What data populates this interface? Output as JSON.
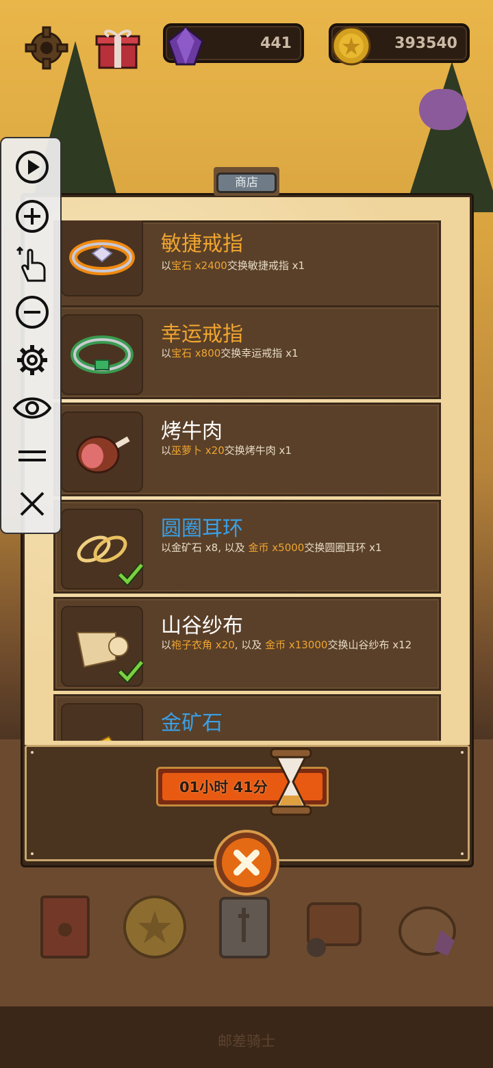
{
  "resources": {
    "gems": "441",
    "coins": "393540"
  },
  "shop": {
    "tab_label": "商店",
    "items": [
      {
        "name": "敏捷戒指",
        "name_color": "#f0a530",
        "desc_pre": "以",
        "desc_hl": "宝石 x2400",
        "desc_post": "交换敏捷戒指 x1",
        "icon": "agility-ring-icon",
        "owned": false
      },
      {
        "name": "幸运戒指",
        "name_color": "#f0a530",
        "desc_pre": "以",
        "desc_hl": "宝石 x800",
        "desc_post": "交换幸运戒指 x1",
        "icon": "luck-ring-icon",
        "owned": false
      },
      {
        "name": "烤牛肉",
        "name_color": "#ffffff",
        "desc_pre": "以",
        "desc_hl": "巫萝卜 x20",
        "desc_post": "交换烤牛肉 x1",
        "icon": "roast-beef-icon",
        "owned": false
      },
      {
        "name": "圆圈耳环",
        "name_color": "#3aa0e8",
        "desc_pre": "以金矿石 x8, 以及 ",
        "desc_hl": "金币 x5000",
        "desc_post": "交换圆圈耳环 x1",
        "icon": "hoop-earring-icon",
        "owned": true
      },
      {
        "name": "山谷纱布",
        "name_color": "#ffffff",
        "desc_pre": "以",
        "desc_hl": "袍子衣角 x20",
        "desc_mid": ", 以及 ",
        "desc_hl2": "金币 x13000",
        "desc_post": "交换山谷纱布 x12",
        "icon": "valley-gauze-icon",
        "owned": true
      },
      {
        "name": "金矿石",
        "name_color": "#3aa0e8",
        "desc_pre": "",
        "desc_hl": "",
        "desc_post": "",
        "icon": "gold-ore-icon",
        "owned": false
      }
    ]
  },
  "timer": {
    "text": "01小时 41分"
  },
  "footer": {
    "title": "邮差骑士"
  },
  "toolbar": {
    "buttons": [
      "play-icon",
      "zoom-in-icon",
      "touch-icon",
      "zoom-out-icon",
      "settings-icon",
      "eye-icon",
      "menu-icon",
      "close-icon"
    ]
  },
  "colors": {
    "accent_orange": "#f0a530",
    "accent_blue": "#3aa0e8",
    "panel_brown": "#5a4028"
  }
}
